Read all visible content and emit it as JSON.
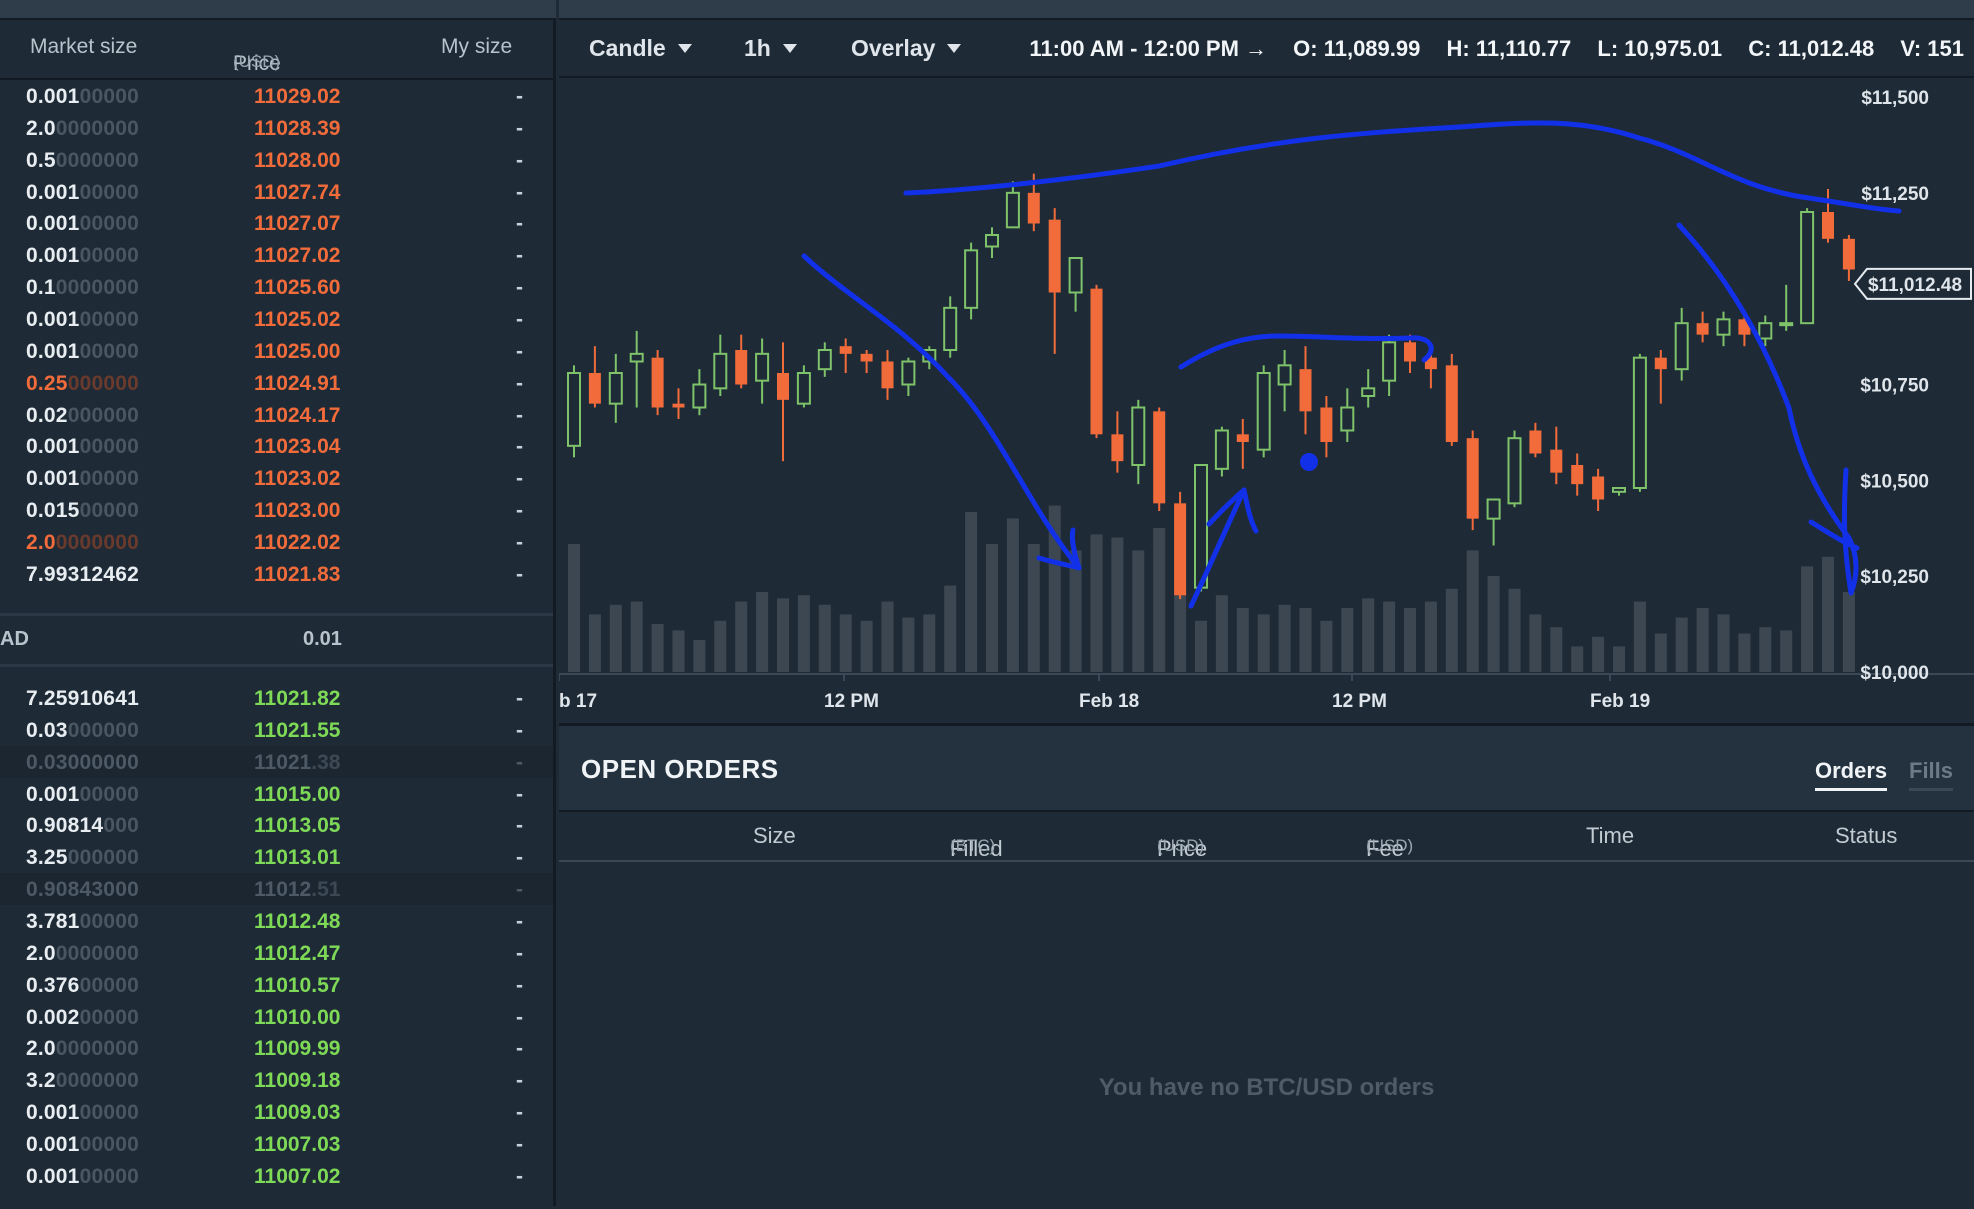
{
  "orderbook": {
    "headers": {
      "market_size": "Market size",
      "price": "Price",
      "price_unit": "(USD)",
      "my_size": "My size"
    },
    "asks": [
      {
        "size_main": "0.001",
        "size_dim": "00000",
        "price_main": "11029",
        "price_dec": ".02",
        "my": "-"
      },
      {
        "size_main": "2.0",
        "size_dim": "0000000",
        "price_main": "11028",
        "price_dec": ".39",
        "my": "-"
      },
      {
        "size_main": "0.5",
        "size_dim": "0000000",
        "price_main": "11028",
        "price_dec": ".00",
        "my": "-"
      },
      {
        "size_main": "0.001",
        "size_dim": "00000",
        "price_main": "11027",
        "price_dec": ".74",
        "my": "-"
      },
      {
        "size_main": "0.001",
        "size_dim": "00000",
        "price_main": "11027",
        "price_dec": ".07",
        "my": "-"
      },
      {
        "size_main": "0.001",
        "size_dim": "00000",
        "price_main": "11027",
        "price_dec": ".02",
        "my": "-"
      },
      {
        "size_main": "0.1",
        "size_dim": "0000000",
        "price_main": "11025",
        "price_dec": ".60",
        "my": "-"
      },
      {
        "size_main": "0.001",
        "size_dim": "00000",
        "price_main": "11025",
        "price_dec": ".02",
        "my": "-"
      },
      {
        "size_main": "0.001",
        "size_dim": "00000",
        "price_main": "11025",
        "price_dec": ".00",
        "my": "-"
      },
      {
        "size_main": "0.25",
        "size_dim": "000000",
        "price_main": "11024",
        "price_dec": ".91",
        "my": "-",
        "highlight": true
      },
      {
        "size_main": "0.02",
        "size_dim": "000000",
        "price_main": "11024",
        "price_dec": ".17",
        "my": "-"
      },
      {
        "size_main": "0.001",
        "size_dim": "00000",
        "price_main": "11023",
        "price_dec": ".04",
        "my": "-"
      },
      {
        "size_main": "0.001",
        "size_dim": "00000",
        "price_main": "11023",
        "price_dec": ".02",
        "my": "-"
      },
      {
        "size_main": "0.015",
        "size_dim": "00000",
        "price_main": "11023",
        "price_dec": ".00",
        "my": "-"
      },
      {
        "size_main": "2.0",
        "size_dim": "0000000",
        "price_main": "11022",
        "price_dec": ".02",
        "my": "-",
        "highlight": true
      },
      {
        "size_main": "7.99312462",
        "size_dim": "",
        "price_main": "11021",
        "price_dec": ".83",
        "my": "-"
      }
    ],
    "spread": {
      "label": "AD",
      "value": "0.01"
    },
    "bids": [
      {
        "size_main": "7.25910641",
        "size_dim": "",
        "price_main": "11021",
        "price_dec": ".82",
        "my": "-"
      },
      {
        "size_main": "0.03",
        "size_dim": "000000",
        "price_main": "11021",
        "price_dec": ".55",
        "my": "-"
      },
      {
        "size_main": "0.03000000",
        "size_dim": "",
        "price_main": "11021",
        "price_dec": ".38",
        "my": "-",
        "muted": true
      },
      {
        "size_main": "0.001",
        "size_dim": "00000",
        "price_main": "11015",
        "price_dec": ".00",
        "my": "-"
      },
      {
        "size_main": "0.90814",
        "size_dim": "000",
        "price_main": "11013",
        "price_dec": ".05",
        "my": "-"
      },
      {
        "size_main": "3.25",
        "size_dim": "000000",
        "price_main": "11013",
        "price_dec": ".01",
        "my": "-"
      },
      {
        "size_main": "0.90843000",
        "size_dim": "",
        "price_main": "11012",
        "price_dec": ".51",
        "my": "-",
        "muted": true
      },
      {
        "size_main": "3.781",
        "size_dim": "00000",
        "price_main": "11012",
        "price_dec": ".48",
        "my": "-"
      },
      {
        "size_main": "2.0",
        "size_dim": "0000000",
        "price_main": "11012",
        "price_dec": ".47",
        "my": "-"
      },
      {
        "size_main": "0.376",
        "size_dim": "00000",
        "price_main": "11010",
        "price_dec": ".57",
        "my": "-"
      },
      {
        "size_main": "0.002",
        "size_dim": "00000",
        "price_main": "11010",
        "price_dec": ".00",
        "my": "-"
      },
      {
        "size_main": "2.0",
        "size_dim": "0000000",
        "price_main": "11009",
        "price_dec": ".99",
        "my": "-"
      },
      {
        "size_main": "3.2",
        "size_dim": "0000000",
        "price_main": "11009",
        "price_dec": ".18",
        "my": "-"
      },
      {
        "size_main": "0.001",
        "size_dim": "00000",
        "price_main": "11009",
        "price_dec": ".03",
        "my": "-"
      },
      {
        "size_main": "0.001",
        "size_dim": "00000",
        "price_main": "11007",
        "price_dec": ".03",
        "my": "-"
      },
      {
        "size_main": "0.001",
        "size_dim": "00000",
        "price_main": "11007",
        "price_dec": ".02",
        "my": "-"
      }
    ]
  },
  "toolbar": {
    "chart_type": "Candle",
    "interval": "1h",
    "overlay": "Overlay",
    "time_range": "11:00 AM - 12:00 PM →",
    "open": "O: 11,089.99",
    "high": "H: 11,110.77",
    "low": "L: 10,975.01",
    "close": "C: 11,012.48",
    "volume": "V: 151",
    "caret_icon": "caret-down-icon"
  },
  "colors": {
    "up": "#7ec26a",
    "down": "#f26b3a",
    "annotation": "#1230e8",
    "volume": "#3c4752",
    "bg": "#1e2b37"
  },
  "chart_data": {
    "type": "candlestick",
    "y_range": [
      10000,
      11500
    ],
    "y_ticks": [
      "$11,500",
      "$11,250",
      "$10,750",
      "$10,500",
      "$10,250",
      "$10,000"
    ],
    "y_tick_values": [
      11500,
      11250,
      10750,
      10500,
      10250,
      10000
    ],
    "x_ticks": [
      "b 17",
      "12 PM",
      "Feb 18",
      "12 PM",
      "Feb 19"
    ],
    "last_price_label": "$11,012.48",
    "last_price": 11012.48,
    "candles": [
      [
        10590,
        10800,
        10780,
        10560,
        40
      ],
      [
        10780,
        10850,
        10700,
        10690,
        18
      ],
      [
        10700,
        10830,
        10780,
        10650,
        21
      ],
      [
        10810,
        10890,
        10830,
        10690,
        22
      ],
      [
        10820,
        10840,
        10690,
        10670,
        15
      ],
      [
        10700,
        10740,
        10690,
        10660,
        13
      ],
      [
        10690,
        10790,
        10750,
        10670,
        10
      ],
      [
        10740,
        10880,
        10830,
        10720,
        16
      ],
      [
        10840,
        10880,
        10750,
        10740,
        22
      ],
      [
        10760,
        10870,
        10830,
        10700,
        25
      ],
      [
        10780,
        10860,
        10710,
        10550,
        23
      ],
      [
        10700,
        10800,
        10780,
        10690,
        24
      ],
      [
        10790,
        10860,
        10840,
        10770,
        21
      ],
      [
        10850,
        10870,
        10830,
        10780,
        18
      ],
      [
        10830,
        10840,
        10810,
        10780,
        16
      ],
      [
        10810,
        10840,
        10740,
        10710,
        22
      ],
      [
        10750,
        10820,
        10810,
        10720,
        17
      ],
      [
        10810,
        10850,
        10840,
        10790,
        18
      ],
      [
        10840,
        10980,
        10950,
        10820,
        27
      ],
      [
        10950,
        11120,
        11100,
        10920,
        50
      ],
      [
        11110,
        11160,
        11140,
        11080,
        40
      ],
      [
        11160,
        11280,
        11250,
        11160,
        48
      ],
      [
        11250,
        11300,
        11170,
        11150,
        40
      ],
      [
        11180,
        11210,
        10990,
        10830,
        52
      ],
      [
        10990,
        11070,
        11080,
        10940,
        38
      ],
      [
        11000,
        11010,
        10620,
        10610,
        43
      ],
      [
        10620,
        10680,
        10550,
        10520,
        42
      ],
      [
        10540,
        10710,
        10690,
        10490,
        38
      ],
      [
        10680,
        10690,
        10440,
        10420,
        45
      ],
      [
        10440,
        10470,
        10200,
        10190,
        24
      ],
      [
        10220,
        10520,
        10540,
        10210,
        16
      ],
      [
        10530,
        10640,
        10630,
        10510,
        24
      ],
      [
        10620,
        10660,
        10600,
        10530,
        20
      ],
      [
        10580,
        10800,
        10780,
        10560,
        18
      ],
      [
        10750,
        10840,
        10800,
        10680,
        21
      ],
      [
        10790,
        10850,
        10680,
        10620,
        20
      ],
      [
        10690,
        10720,
        10600,
        10560,
        16
      ],
      [
        10630,
        10740,
        10690,
        10600,
        20
      ],
      [
        10720,
        10790,
        10740,
        10690,
        23
      ],
      [
        10760,
        10880,
        10860,
        10720,
        22
      ],
      [
        10860,
        10880,
        10810,
        10780,
        20
      ],
      [
        10820,
        10830,
        10790,
        10740,
        22
      ],
      [
        10800,
        10830,
        10600,
        10590,
        26
      ],
      [
        10610,
        10630,
        10400,
        10370,
        38
      ],
      [
        10400,
        10450,
        10450,
        10330,
        30
      ],
      [
        10440,
        10630,
        10610,
        10430,
        26
      ],
      [
        10630,
        10650,
        10570,
        10560,
        18
      ],
      [
        10580,
        10640,
        10520,
        10490,
        14
      ],
      [
        10540,
        10570,
        10490,
        10460,
        8
      ],
      [
        10510,
        10530,
        10450,
        10420,
        11
      ],
      [
        10470,
        10480,
        10480,
        10460,
        8
      ],
      [
        10480,
        10830,
        10820,
        10470,
        22
      ],
      [
        10820,
        10840,
        10790,
        10700,
        12
      ],
      [
        10790,
        10950,
        10910,
        10760,
        17
      ],
      [
        10910,
        10940,
        10880,
        10860,
        20
      ],
      [
        10880,
        10940,
        10920,
        10850,
        18
      ],
      [
        10920,
        10940,
        10880,
        10850,
        12
      ],
      [
        10870,
        10930,
        10910,
        10850,
        14
      ],
      [
        10910,
        11010,
        10910,
        10890,
        13
      ],
      [
        10910,
        11210,
        11200,
        10910,
        33
      ],
      [
        11200,
        11260,
        11130,
        11120,
        36
      ],
      [
        11130,
        11140,
        11050,
        11020,
        25
      ]
    ],
    "volume_unit": "relative (0-50)"
  },
  "open_orders": {
    "title": "OPEN ORDERS",
    "tabs": {
      "orders": "Orders",
      "fills": "Fills"
    },
    "columns": {
      "size": "Size",
      "filled": "Filled",
      "filled_unit": "(BTC)",
      "price": "Price",
      "price_unit": "(USD)",
      "fee": "Fee",
      "fee_unit": "(USD)",
      "time": "Time",
      "status": "Status"
    },
    "empty_message": "You have no BTC/USD orders"
  }
}
